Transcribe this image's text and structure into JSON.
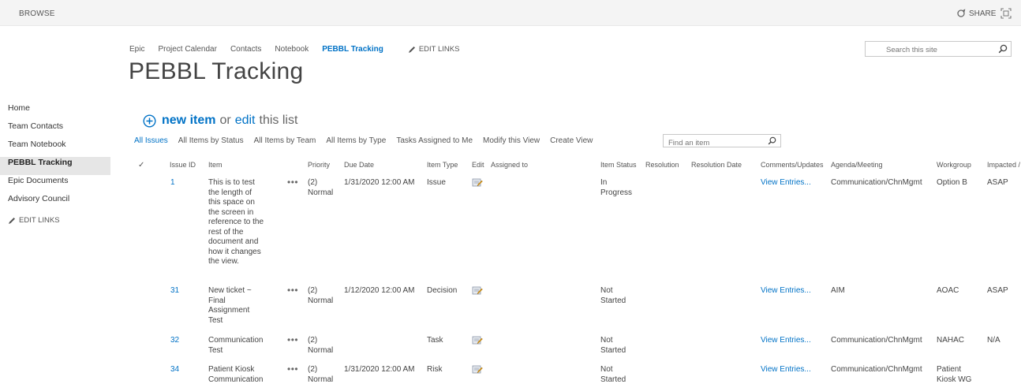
{
  "ribbon": {
    "browse": "BROWSE",
    "share": "SHARE"
  },
  "topnav": {
    "links": [
      {
        "label": "Epic"
      },
      {
        "label": "Project Calendar"
      },
      {
        "label": "Contacts"
      },
      {
        "label": "Notebook"
      },
      {
        "label": "PEBBL Tracking",
        "active": true
      }
    ],
    "edit_links": "EDIT LINKS"
  },
  "search": {
    "placeholder": "Search this site"
  },
  "page": {
    "title": "PEBBL Tracking"
  },
  "leftnav": {
    "items": [
      {
        "label": "Home"
      },
      {
        "label": "Team Contacts"
      },
      {
        "label": "Team Notebook"
      },
      {
        "label": "PEBBL Tracking",
        "active": true
      },
      {
        "label": "Epic Documents"
      },
      {
        "label": "Advisory Council"
      }
    ],
    "edit_links": "EDIT LINKS"
  },
  "newitem": {
    "new_label": "new item",
    "or": "or",
    "edit": "edit",
    "tail": "this list"
  },
  "views": {
    "items": [
      {
        "label": "All Issues",
        "active": true
      },
      {
        "label": "All Items by Status"
      },
      {
        "label": "All Items by Team"
      },
      {
        "label": "All Items by Type"
      },
      {
        "label": "Tasks Assigned to Me"
      },
      {
        "label": "Modify this View"
      },
      {
        "label": "Create View"
      }
    ],
    "find_placeholder": "Find an item"
  },
  "columns": {
    "check": "✓",
    "issue_id": "Issue ID",
    "item": "Item",
    "priority": "Priority",
    "due_date": "Due Date",
    "item_type": "Item Type",
    "edit": "Edit",
    "assigned_to": "Assigned to",
    "item_status": "Item Status",
    "resolution": "Resolution",
    "resolution_date": "Resolution Date",
    "comments": "Comments/Updates",
    "agenda": "Agenda/Meeting",
    "workgroup": "Workgroup",
    "impacted": "Impacted /"
  },
  "rows": [
    {
      "id": "1",
      "item_lines": [
        "This is to test",
        "the length of",
        "this space on",
        "the screen in",
        "reference to the",
        "rest of the",
        "document and",
        "how it changes",
        "the view."
      ],
      "priority_lines": [
        "(2)",
        "Normal"
      ],
      "due": "1/31/2020 12:00 AM",
      "type": "Issue",
      "status_lines": [
        "In",
        "Progress"
      ],
      "comments": "View Entries...",
      "agenda": "Communication/ChnMgmt",
      "workgroup_lines": [
        "Option B"
      ],
      "impacted": "ASAP"
    },
    {
      "id": "31",
      "item_lines": [
        "New ticket ~",
        "Final",
        "Assignment",
        "Test"
      ],
      "priority_lines": [
        "(2)",
        "Normal"
      ],
      "due": "1/12/2020 12:00 AM",
      "type": "Decision",
      "status_lines": [
        "Not",
        "Started"
      ],
      "comments": "View Entries...",
      "agenda": "AIM",
      "workgroup_lines": [
        "AOAC"
      ],
      "impacted": "ASAP"
    },
    {
      "id": "32",
      "item_lines": [
        "Communication",
        "Test"
      ],
      "priority_lines": [
        "(2)",
        "Normal"
      ],
      "due": "",
      "type": "Task",
      "status_lines": [
        "Not",
        "Started"
      ],
      "comments": "View Entries...",
      "agenda": "Communication/ChnMgmt",
      "workgroup_lines": [
        "NAHAC"
      ],
      "impacted": "N/A"
    },
    {
      "id": "34",
      "item_lines": [
        "Patient Kiosk",
        "Communication"
      ],
      "priority_lines": [
        "(2)",
        "Normal"
      ],
      "due": "1/31/2020 12:00 AM",
      "type": "Risk",
      "status_lines": [
        "Not",
        "Started"
      ],
      "comments": "View Entries...",
      "agenda": "Communication/ChnMgmt",
      "workgroup_lines": [
        "Patient",
        "Kiosk WG"
      ],
      "impacted": ""
    }
  ],
  "colors": {
    "accent": "#0072c6",
    "text": "#444444",
    "ribbon": "#f4f4f4"
  }
}
